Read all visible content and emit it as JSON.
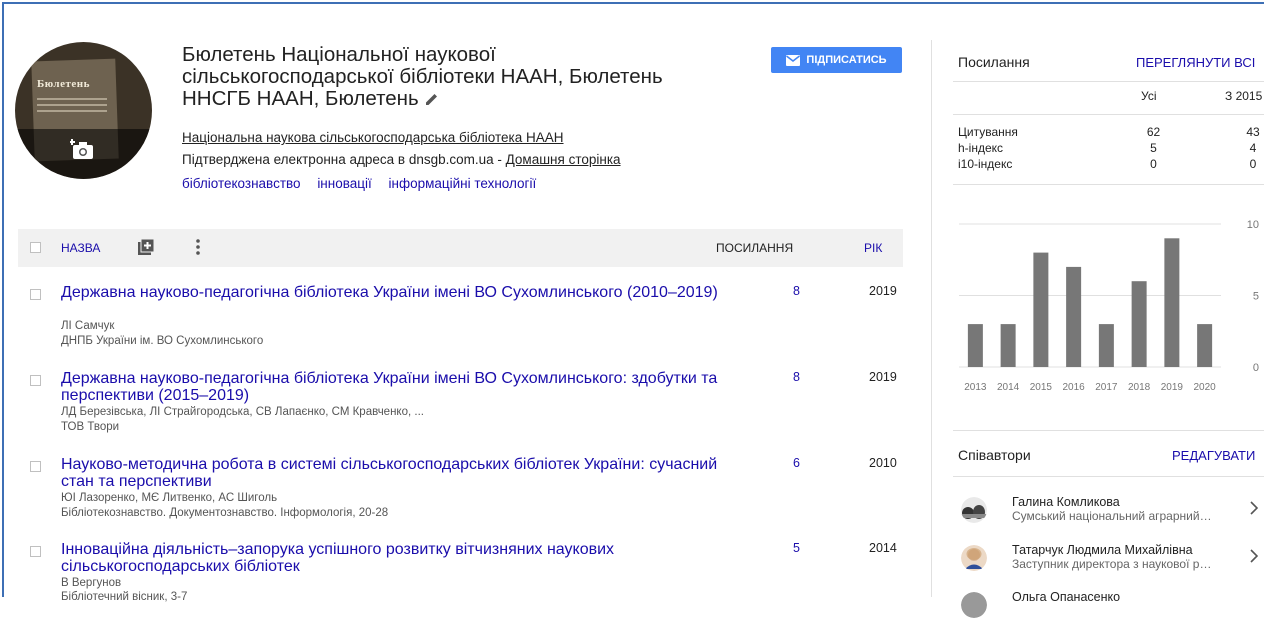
{
  "profile": {
    "name": "Бюлетень Національної наукової сільськогосподарської бібліотеки НААН, Бюлетень ННСГБ НААН, Бюлетень",
    "avatar_text": "Бюлетень",
    "affiliation": "Національна наукова сільськогосподарська бібліотека НААН",
    "email_text": "Підтверджена електронна адреса в dnsgb.com.ua - ",
    "homepage_label": "Домашня сторінка",
    "interests": [
      "бібліотекознавство",
      "інновації",
      "інформаційні технології"
    ],
    "subscribe_label": "ПІДПИСАТИСЬ"
  },
  "table": {
    "col_title": "НАЗВА",
    "col_cites": "ПОСИЛАННЯ",
    "col_year": "РІК",
    "rows": [
      {
        "title": "Державна науково-педагогічна бібліотека України імені ВО Сухомлинського (2010–2019)",
        "authors": "ЛІ Самчук",
        "pub": "ДНПБ України ім. ВО Сухомлинського",
        "cites": "8",
        "year": "2019"
      },
      {
        "title": "Державна науково-педагогічна бібліотека України імені ВО Сухомлинського: здобутки та перспективи (2015–2019)",
        "authors": "ЛД Березівська, ЛІ Страйгородська, СВ Лапаєнко, СМ Кравченко, ...",
        "pub": "ТОВ Твори",
        "cites": "8",
        "year": "2019"
      },
      {
        "title": "Науково-методична робота в системі сільськогосподарських бібліотек України: сучасний стан та перспективи",
        "authors": "ЮІ Лазоренко, МЄ Литвенко, АС Шиголь",
        "pub": "Бібліотекознавство. Документознавство. Інформологія, 20-28",
        "cites": "6",
        "year": "2010"
      },
      {
        "title": "Інноваційна діяльність–запорука успішного розвитку вітчизняних наукових сільськогосподарських бібліотек",
        "authors": "В Вергунов",
        "pub": "Бібліотечний вісник, 3-7",
        "cites": "5",
        "year": "2014"
      }
    ]
  },
  "citations": {
    "title": "Посилання",
    "view_all": "ПЕРЕГЛЯНУТИ ВСІ",
    "col_all": "Усі",
    "col_since": "З 2015",
    "rows": [
      {
        "label": "Цитування",
        "all": "62",
        "since": "43"
      },
      {
        "label": "h-індекс",
        "all": "5",
        "since": "4"
      },
      {
        "label": "i10-індекс",
        "all": "0",
        "since": "0"
      }
    ]
  },
  "chart_data": {
    "type": "bar",
    "categories": [
      "2013",
      "2014",
      "2015",
      "2016",
      "2017",
      "2018",
      "2019",
      "2020"
    ],
    "values": [
      3,
      3,
      8,
      7,
      3,
      6,
      9,
      3
    ],
    "yticks": [
      "10",
      "5",
      "0"
    ],
    "ylim": [
      0,
      10
    ],
    "grid": true,
    "bar_color": "#777777"
  },
  "coauthors": {
    "title": "Співавтори",
    "edit": "РЕДАГУВАТИ",
    "items": [
      {
        "name": "Галина Комликова",
        "affiliation": "Сумський національний аграрний університет"
      },
      {
        "name": "Татарчук Людмила Михайлівна",
        "affiliation": "Заступник директора з наукової роботи"
      },
      {
        "name": "Ольга Опанасенко",
        "affiliation": ""
      }
    ]
  }
}
